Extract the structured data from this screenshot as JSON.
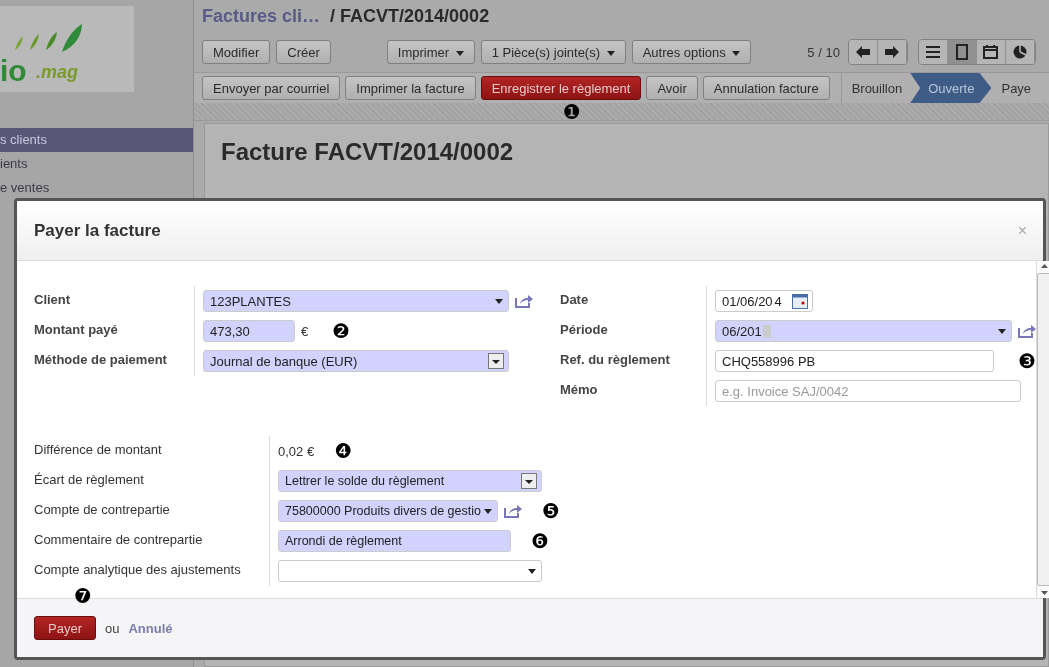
{
  "logo": {
    "text": "io",
    "subtext": ".mag"
  },
  "sidebar": {
    "items": [
      {
        "label": "s clients",
        "selected": true
      },
      {
        "label": "ients",
        "selected": false
      },
      {
        "label": "e ventes",
        "selected": false
      }
    ]
  },
  "breadcrumb": {
    "parent": "Factures cli…",
    "current": "/ FACVT/2014/0002"
  },
  "toolbar": {
    "buttons": [
      "Modifier",
      "Créer"
    ],
    "menus": [
      "Imprimer",
      "1 Pièce(s) jointe(s)",
      "Autres options"
    ],
    "pager": "5 / 10",
    "views": [
      {
        "kind": "list",
        "selected": false
      },
      {
        "kind": "form",
        "selected": true
      },
      {
        "kind": "calendar",
        "selected": false
      },
      {
        "kind": "graph",
        "selected": false
      }
    ]
  },
  "actions": [
    {
      "label": "Envoyer par courriel",
      "primary": false
    },
    {
      "label": "Imprimer la facture",
      "primary": false
    },
    {
      "label": "Enregistrer le règlement",
      "primary": true,
      "marker": "❶"
    },
    {
      "label": "Avoir",
      "primary": false
    },
    {
      "label": "Annulation facture",
      "primary": false
    }
  ],
  "statusbar": [
    {
      "label": "Brouillon",
      "selected": false
    },
    {
      "label": "Ouverte",
      "selected": true
    },
    {
      "label": "Paye",
      "selected": false
    }
  ],
  "form_title": "Facture FACVT/2014/0002",
  "dialog": {
    "title": "Payer la facture",
    "close": "×",
    "left_fields": [
      {
        "label": "Client",
        "kind": "many2one",
        "value": "123PLANTES",
        "required": true,
        "link": true
      },
      {
        "label": "Montant payé",
        "kind": "amount",
        "value": "473,30",
        "currency": "€",
        "required": true,
        "marker": "❷"
      },
      {
        "label": "Méthode de paiement",
        "kind": "selection",
        "value": "Journal de banque (EUR)",
        "required": true
      }
    ],
    "right_fields": [
      {
        "label": "Date",
        "kind": "date",
        "value": "01/06/20",
        "value_after": "4",
        "required": false
      },
      {
        "label": "Période",
        "kind": "many2one",
        "value": "06/201",
        "redacted": true,
        "required": true,
        "link": true
      },
      {
        "label": "Ref. du règlement",
        "kind": "input",
        "value": "CHQ558996 PB",
        "required": false,
        "marker": "❸"
      },
      {
        "label": "Mémo",
        "kind": "input",
        "placeholder": "e.g. Invoice SAJ/0042",
        "required": false
      }
    ],
    "adjust_fields": [
      {
        "label": "Différence de montant",
        "kind": "static",
        "value": "0,02 €",
        "marker": "❹"
      },
      {
        "label": "Écart de règlement",
        "kind": "selection",
        "value": "Lettrer le solde du règlement",
        "required": true
      },
      {
        "label": "Compte de contrepartie",
        "kind": "many2one",
        "value": "75800000 Produits divers de gestio",
        "required": true,
        "link": true,
        "marker": "❺"
      },
      {
        "label": "Commentaire de contrepartie",
        "kind": "input",
        "value": "Arrondi de règlement",
        "required": true,
        "marker": "❻"
      },
      {
        "label": "Compte analytique des ajustements",
        "kind": "many2one",
        "required": false
      }
    ],
    "footer": {
      "button": "Payer",
      "marker": "❼",
      "or": "ou",
      "cancel": "Annulé"
    }
  }
}
